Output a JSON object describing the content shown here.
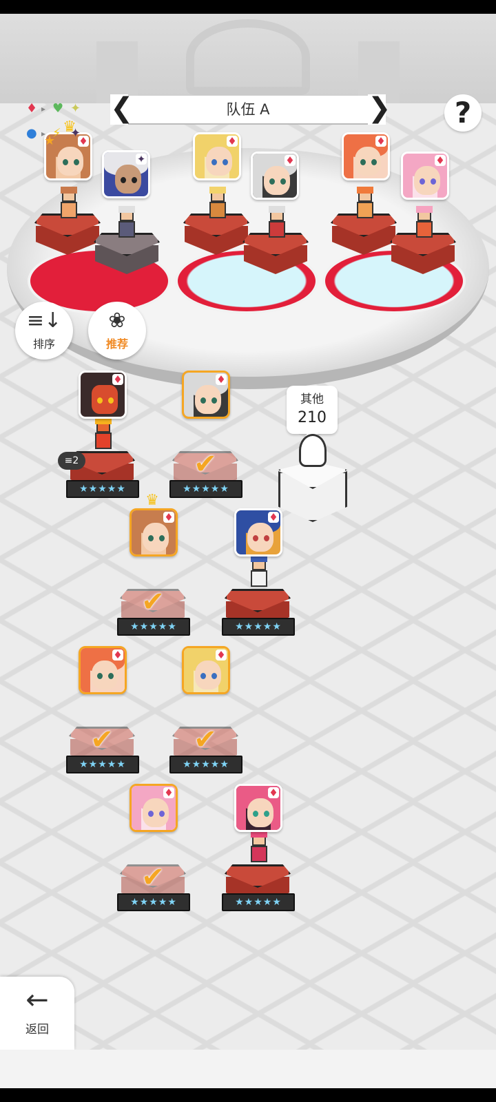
{
  "header": {
    "team_name": "队伍 A",
    "prev_label": "❮",
    "next_label": "❯",
    "help_label": "?"
  },
  "element_chart": {
    "symbols": [
      "♦",
      "▸",
      "♥",
      "✦",
      "●",
      "▸",
      "⚡",
      "✦"
    ]
  },
  "toolbar": {
    "sort_label": "排序",
    "sort_icon": "≡↓",
    "recommend_label": "推荐",
    "recommend_icon": "❀"
  },
  "team_slots": [
    {
      "id": "slot-1",
      "portraits": [
        {
          "character": "brunette-leader",
          "suit": "♦",
          "leader": true,
          "star": "★"
        },
        {
          "character": "white-haired-elder",
          "suit": "✦",
          "dark": true
        }
      ]
    },
    {
      "id": "slot-2",
      "portraits": [
        {
          "character": "blonde-girl",
          "suit": "♦"
        },
        {
          "character": "silver-haired-girl",
          "suit": "♦"
        }
      ]
    },
    {
      "id": "slot-3",
      "portraits": [
        {
          "character": "ginger-girl",
          "suit": "♦"
        },
        {
          "character": "pink-haired-girl",
          "suit": "♦"
        }
      ]
    }
  ],
  "other": {
    "label": "其他",
    "count": "210"
  },
  "roster": [
    {
      "character": "red-dragon",
      "suit": "♦",
      "selected": false,
      "stars": "★★★★★",
      "badge": "≡2"
    },
    {
      "character": "silver-haired-girl",
      "suit": "♦",
      "selected": true,
      "stars": "★★★★★",
      "check": "✔"
    },
    {
      "character": "brunette-leader",
      "suit": "♦",
      "selected": true,
      "stars": "★★★★★",
      "check": "✔",
      "leader": true
    },
    {
      "character": "blue-haired-boy",
      "suit": "♦",
      "selected": false,
      "stars": "★★★★★"
    },
    {
      "character": "ginger-girl",
      "suit": "♦",
      "selected": true,
      "stars": "★★★★★",
      "check": "✔"
    },
    {
      "character": "blonde-girl",
      "suit": "♦",
      "selected": true,
      "stars": "★★★★★",
      "check": "✔"
    },
    {
      "character": "pink-haired-girl",
      "suit": "♦",
      "selected": true,
      "stars": "★★★★★",
      "check": "✔"
    },
    {
      "character": "magenta-haired-girl",
      "suit": "♦",
      "selected": false,
      "stars": "★★★★★"
    }
  ],
  "footer": {
    "back_label": "返回",
    "back_icon": "←"
  },
  "colors": {
    "accent": "#f5a623",
    "suit_red": "#e23750",
    "pedestal": "#c94a3a",
    "stage_red": "#e21f3a"
  }
}
